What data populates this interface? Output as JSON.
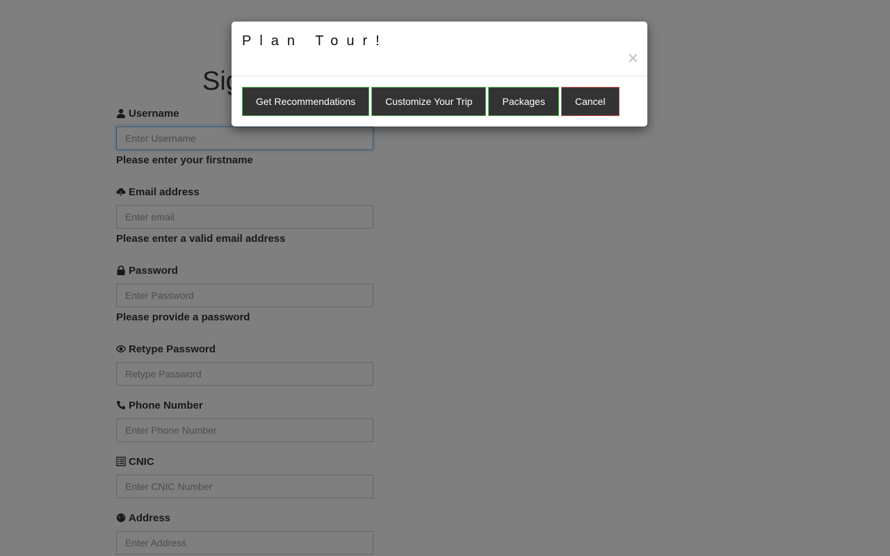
{
  "form": {
    "title": "Sign Up",
    "fields": [
      {
        "label": "Username",
        "icon": "user-icon",
        "placeholder": "Enter Username",
        "help": "Please enter your firstname"
      },
      {
        "label": "Email address",
        "icon": "cloud-upload-icon",
        "placeholder": "Enter email",
        "help": "Please enter a valid email address"
      },
      {
        "label": "Password",
        "icon": "lock-icon",
        "placeholder": "Enter Password",
        "help": "Please provide a password"
      },
      {
        "label": "Retype Password",
        "icon": "eye-icon",
        "placeholder": "Retype Password"
      },
      {
        "label": "Phone Number",
        "icon": "phone-icon",
        "placeholder": "Enter Phone Number"
      },
      {
        "label": "CNIC",
        "icon": "list-alt-icon",
        "placeholder": "Enter CNIC Number"
      },
      {
        "label": "Address",
        "icon": "globe-icon",
        "placeholder": "Enter Address"
      }
    ]
  },
  "modal": {
    "title": "Plan Tour!",
    "close_symbol": "×",
    "buttons": {
      "recommendations": "Get Recommendations",
      "customize": "Customize Your Trip",
      "packages": "Packages",
      "cancel": "Cancel"
    }
  },
  "colors": {
    "backdrop": "#7f7f7f",
    "button_bg": "#333333",
    "button_border_green": "#5cb85c",
    "button_border_red": "#d9534f",
    "focus_border": "#66afe9"
  }
}
